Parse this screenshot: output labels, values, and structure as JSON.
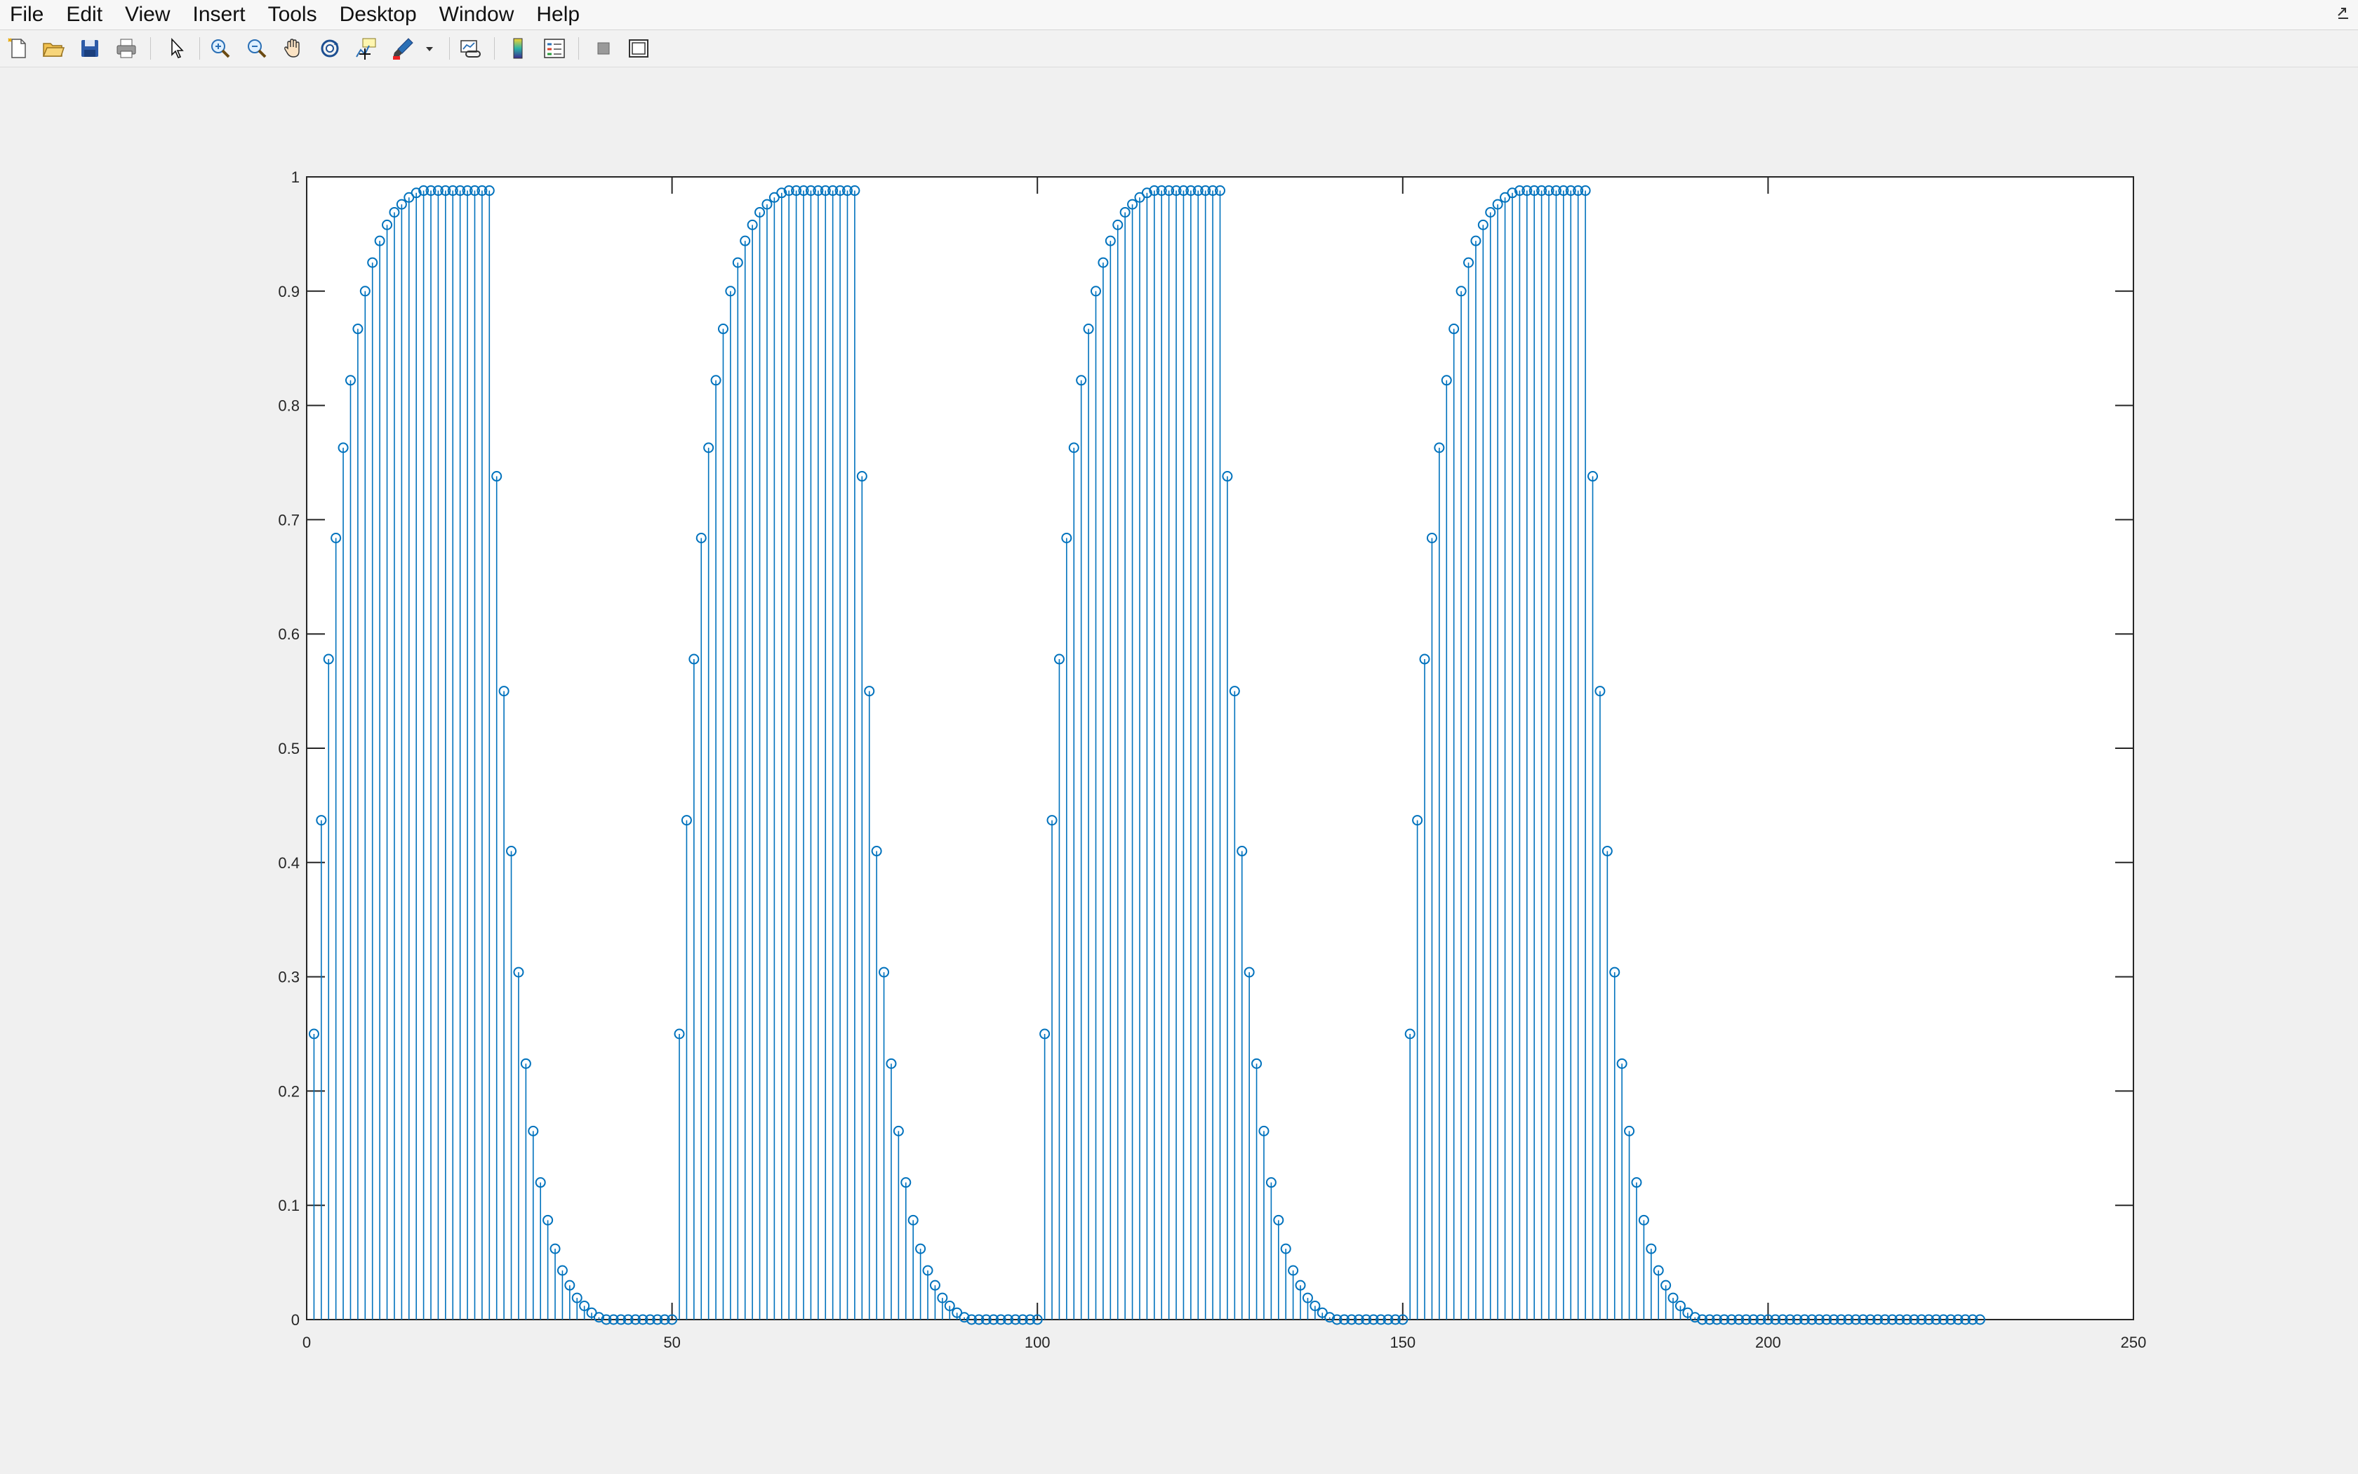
{
  "menubar": {
    "items": [
      {
        "label": "File"
      },
      {
        "label": "Edit"
      },
      {
        "label": "View"
      },
      {
        "label": "Insert"
      },
      {
        "label": "Tools"
      },
      {
        "label": "Desktop"
      },
      {
        "label": "Window"
      },
      {
        "label": "Help"
      }
    ]
  },
  "toolbar": {
    "buttons": [
      {
        "icon": "new-figure-icon"
      },
      {
        "icon": "open-file-icon"
      },
      {
        "icon": "save-icon"
      },
      {
        "icon": "print-icon"
      },
      {
        "icon": "edit-plot-arrow-icon"
      },
      {
        "icon": "zoom-in-icon"
      },
      {
        "icon": "zoom-out-icon"
      },
      {
        "icon": "pan-hand-icon"
      },
      {
        "icon": "rotate-3d-icon"
      },
      {
        "icon": "data-cursor-icon"
      },
      {
        "icon": "brush-icon"
      },
      {
        "icon": "brush-dropdown-icon"
      },
      {
        "icon": "link-plot-icon"
      },
      {
        "icon": "insert-colorbar-icon"
      },
      {
        "icon": "insert-legend-icon"
      },
      {
        "icon": "hide-plot-tools-icon"
      },
      {
        "icon": "show-plot-tools-icon"
      }
    ]
  },
  "colors": {
    "stem": "#0072BD",
    "background": "#f0f0f0",
    "axes_background": "#ffffff"
  },
  "chart_data": {
    "type": "stem",
    "title": "",
    "xlabel": "",
    "ylabel": "",
    "xlim": [
      0,
      250
    ],
    "ylim": [
      0,
      1
    ],
    "xticks": [
      0,
      50,
      100,
      150,
      200,
      250
    ],
    "xtick_labels": [
      "0",
      "50",
      "100",
      "150",
      "200",
      "250"
    ],
    "yticks": [
      0,
      0.1,
      0.2,
      0.3,
      0.4,
      0.5,
      0.6,
      0.7,
      0.8,
      0.9,
      1
    ],
    "ytick_labels": [
      "0",
      "0.1",
      "0.2",
      "0.3",
      "0.4",
      "0.5",
      "0.6",
      "0.7",
      "0.8",
      "0.9",
      "1"
    ],
    "grid": false,
    "marker": "circle",
    "x_start": 1,
    "x_step": 1,
    "values": [
      0.25,
      0.437,
      0.578,
      0.684,
      0.763,
      0.822,
      0.867,
      0.9,
      0.925,
      0.944,
      0.958,
      0.969,
      0.976,
      0.982,
      0.986,
      0.988,
      0.988,
      0.988,
      0.988,
      0.988,
      0.988,
      0.988,
      0.988,
      0.988,
      0.988,
      0.738,
      0.55,
      0.41,
      0.304,
      0.224,
      0.165,
      0.12,
      0.087,
      0.062,
      0.043,
      0.03,
      0.019,
      0.012,
      0.006,
      0.002,
      0,
      0,
      0,
      0,
      0,
      0,
      0,
      0,
      0,
      0,
      0.25,
      0.437,
      0.578,
      0.684,
      0.763,
      0.822,
      0.867,
      0.9,
      0.925,
      0.944,
      0.958,
      0.969,
      0.976,
      0.982,
      0.986,
      0.988,
      0.988,
      0.988,
      0.988,
      0.988,
      0.988,
      0.988,
      0.988,
      0.988,
      0.988,
      0.738,
      0.55,
      0.41,
      0.304,
      0.224,
      0.165,
      0.12,
      0.087,
      0.062,
      0.043,
      0.03,
      0.019,
      0.012,
      0.006,
      0.002,
      0,
      0,
      0,
      0,
      0,
      0,
      0,
      0,
      0,
      0,
      0.25,
      0.437,
      0.578,
      0.684,
      0.763,
      0.822,
      0.867,
      0.9,
      0.925,
      0.944,
      0.958,
      0.969,
      0.976,
      0.982,
      0.986,
      0.988,
      0.988,
      0.988,
      0.988,
      0.988,
      0.988,
      0.988,
      0.988,
      0.988,
      0.988,
      0.738,
      0.55,
      0.41,
      0.304,
      0.224,
      0.165,
      0.12,
      0.087,
      0.062,
      0.043,
      0.03,
      0.019,
      0.012,
      0.006,
      0.002,
      0,
      0,
      0,
      0,
      0,
      0,
      0,
      0,
      0,
      0,
      0.25,
      0.437,
      0.578,
      0.684,
      0.763,
      0.822,
      0.867,
      0.9,
      0.925,
      0.944,
      0.958,
      0.969,
      0.976,
      0.982,
      0.986,
      0.988,
      0.988,
      0.988,
      0.988,
      0.988,
      0.988,
      0.988,
      0.988,
      0.988,
      0.988,
      0.738,
      0.55,
      0.41,
      0.304,
      0.224,
      0.165,
      0.12,
      0.087,
      0.062,
      0.043,
      0.03,
      0.019,
      0.012,
      0.006,
      0.002,
      0,
      0,
      0,
      0,
      0,
      0,
      0,
      0,
      0,
      0,
      0,
      0,
      0,
      0,
      0,
      0,
      0,
      0,
      0,
      0,
      0,
      0,
      0,
      0,
      0,
      0,
      0,
      0,
      0,
      0,
      0,
      0,
      0,
      0,
      0,
      0,
      0,
      0,
      0
    ]
  }
}
